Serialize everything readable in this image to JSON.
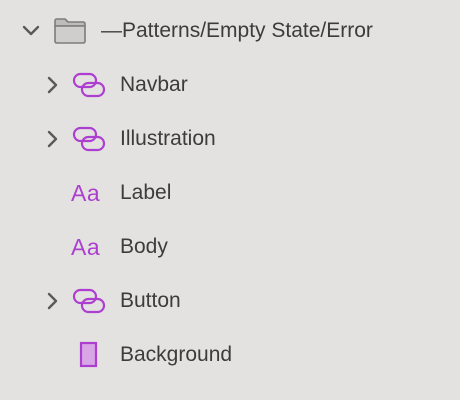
{
  "group": {
    "name": "—Patterns/Empty State/Error",
    "icon": "folder-icon",
    "expanded": true
  },
  "layers": [
    {
      "name": "Navbar",
      "type": "symbol",
      "icon": "symbol-link-icon",
      "expandable": true
    },
    {
      "name": "Illustration",
      "type": "symbol",
      "icon": "symbol-link-icon",
      "expandable": true
    },
    {
      "name": "Label",
      "type": "text-style",
      "icon": "text-style-icon",
      "icon_text": "Aa",
      "expandable": false
    },
    {
      "name": "Body",
      "type": "text-style",
      "icon": "text-style-icon",
      "icon_text": "Aa",
      "expandable": false
    },
    {
      "name": "Button",
      "type": "symbol",
      "icon": "symbol-link-icon",
      "expandable": true
    },
    {
      "name": "Background",
      "type": "rectangle",
      "icon": "rectangle-icon",
      "expandable": false
    }
  ],
  "colors": {
    "background": "#e3e2e1",
    "accent": "#ad3fd0",
    "text": "#3c3c3c",
    "chevron": "#5a5a5a"
  }
}
